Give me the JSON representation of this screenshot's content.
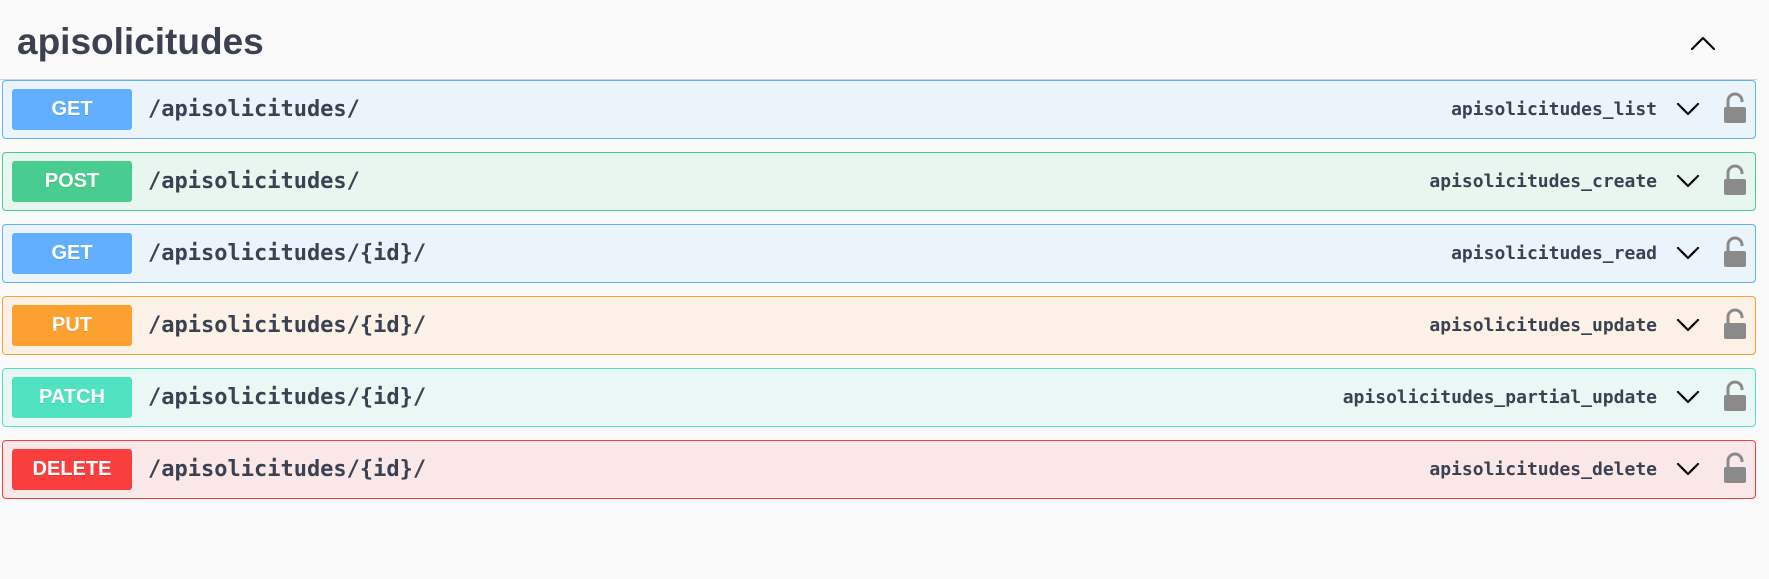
{
  "tag": {
    "title": "apisolicitudes"
  },
  "operations": [
    {
      "method": "GET",
      "path": "/apisolicitudes/",
      "operation_id": "apisolicitudes_list",
      "method_color": "#61affe",
      "bg_color": "#ebf3fb",
      "border_color": "#61affe"
    },
    {
      "method": "POST",
      "path": "/apisolicitudes/",
      "operation_id": "apisolicitudes_create",
      "method_color": "#49cc90",
      "bg_color": "#e8f6f0",
      "border_color": "#49cc90"
    },
    {
      "method": "GET",
      "path": "/apisolicitudes/{id}/",
      "operation_id": "apisolicitudes_read",
      "method_color": "#61affe",
      "bg_color": "#ebf3fb",
      "border_color": "#61affe"
    },
    {
      "method": "PUT",
      "path": "/apisolicitudes/{id}/",
      "operation_id": "apisolicitudes_update",
      "method_color": "#fca130",
      "bg_color": "#fbf1e6",
      "border_color": "#fca130"
    },
    {
      "method": "PATCH",
      "path": "/apisolicitudes/{id}/",
      "operation_id": "apisolicitudes_partial_update",
      "method_color": "#50e3c2",
      "bg_color": "#e9f8f4",
      "border_color": "#50e3c2"
    },
    {
      "method": "DELETE",
      "path": "/apisolicitudes/{id}/",
      "operation_id": "apisolicitudes_delete",
      "method_color": "#f93e3e",
      "bg_color": "#fae7e7",
      "border_color": "#f93e3e"
    }
  ],
  "icons": {
    "collapse": "chevron-up-icon",
    "expand": "chevron-down-icon",
    "lock": "lock-icon"
  }
}
